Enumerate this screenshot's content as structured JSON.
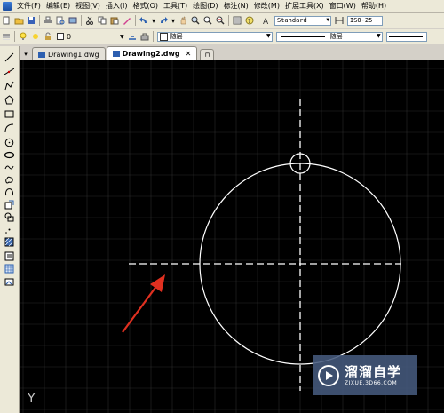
{
  "menu": [
    "文件(F)",
    "编辑(E)",
    "视图(V)",
    "插入(I)",
    "格式(O)",
    "工具(T)",
    "绘图(D)",
    "标注(N)",
    "修改(M)",
    "扩展工具(X)",
    "窗口(W)",
    "帮助(H)"
  ],
  "toolbar1": {
    "text_style": "Standard",
    "dim_style": "ISO-25"
  },
  "toolbar2": {
    "layer_value": "0",
    "color_value": "随层",
    "linetype_value": "随层"
  },
  "tabs": [
    {
      "label": "Drawing1.dwg",
      "active": false
    },
    {
      "label": "Drawing2.dwg",
      "active": true
    }
  ],
  "canvas": {
    "background": "#000000",
    "grid_color": "#2a2a2a",
    "entity_color": "#ffffff",
    "arrow_color": "#e03020",
    "ucs_label": "Y"
  },
  "watermark": {
    "title": "溜溜自学",
    "url": "ZIXUE.3D66.COM"
  }
}
